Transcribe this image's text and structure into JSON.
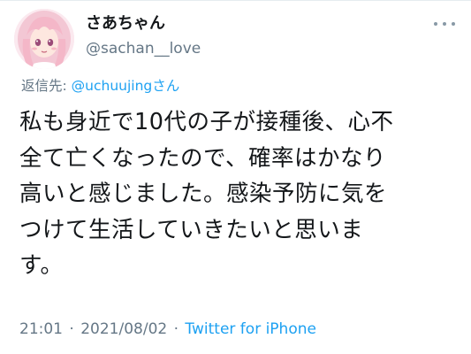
{
  "tweet": {
    "user": {
      "display_name": "さあちゃん",
      "handle": "@sachan__love",
      "avatar_icon": "anime-girl-avatar-icon"
    },
    "more_icon": "more-horizontal-icon",
    "reply": {
      "prefix": "返信先: ",
      "mention": "@uchuujing",
      "suffix": "さん"
    },
    "text": "私も身近で10代の子が接種後、心不\n全て亡くなったので、確率はかなり\n高いと感じました。感染予防に気を\nつけて生活していきたいと思いま\nす。",
    "time": "21:01",
    "separator": "·",
    "date": "2021/08/02",
    "source": "Twitter for iPhone"
  },
  "colors": {
    "text_primary": "#14171a",
    "text_secondary": "#657786",
    "link": "#1da1f2",
    "divider": "#e6ecf0"
  }
}
